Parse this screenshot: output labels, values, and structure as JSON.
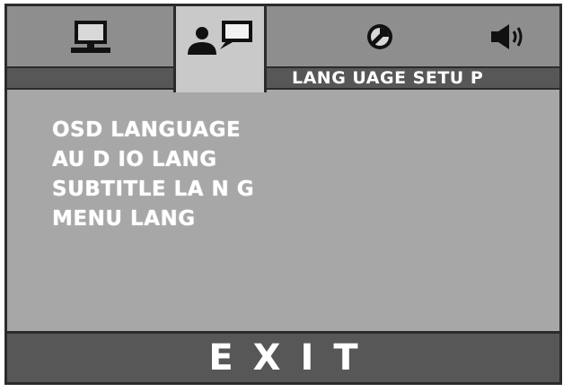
{
  "tabs": [
    {
      "icon": "monitor-icon"
    },
    {
      "icon": "language-person-icon"
    },
    {
      "icon": "video-adjust-icon"
    },
    {
      "icon": "speaker-icon"
    }
  ],
  "active_tab": 1,
  "header": {
    "title": "LANG UAGE SETU P"
  },
  "menu": {
    "items": [
      {
        "label": "OSD LANGUAGE"
      },
      {
        "label": "AU D IO LANG"
      },
      {
        "label": "SUBTITLE LA N G"
      },
      {
        "label": "MENU LANG"
      }
    ]
  },
  "exit": {
    "label": "EXIT"
  },
  "colors": {
    "panel": "#a7a7a7",
    "tab_strip": "#8e8e8e",
    "active_tab": "#c9c9c9",
    "bar": "#575757",
    "border": "#2b2b2b",
    "text": "#ffffff"
  }
}
